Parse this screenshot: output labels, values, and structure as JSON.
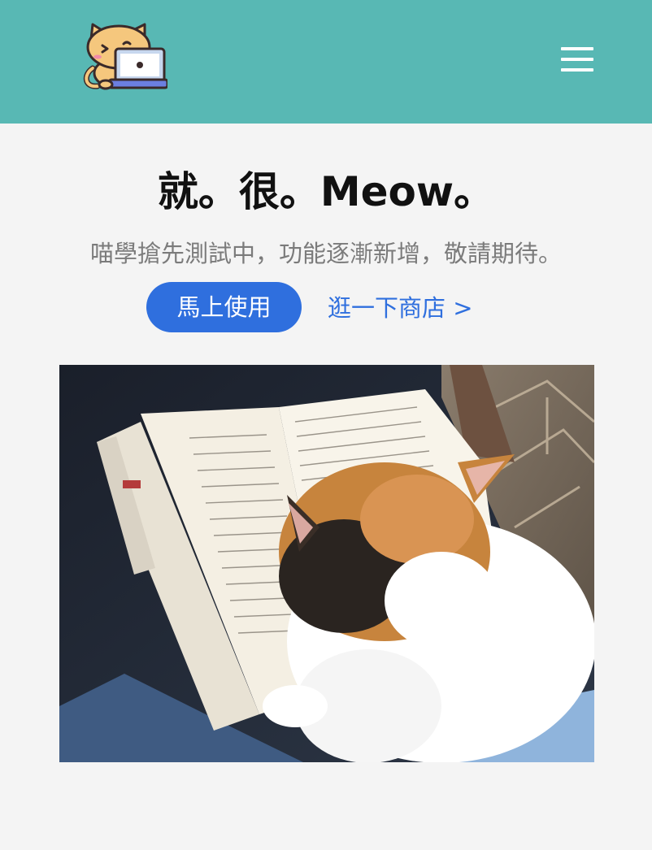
{
  "navbar": {
    "background": "#58b8b4",
    "logo_icon": "cat-with-laptop-icon",
    "menu_icon": "hamburger-menu-icon"
  },
  "hero": {
    "title": "就。很。Meow。",
    "subtitle": "喵學搶先測試中，功能逐漸新增，敬請期待。",
    "primary_cta": "馬上使用",
    "secondary_cta": "逛一下商店 >",
    "accent": "#2f6fde",
    "image_subject": "calico cat reading an open book"
  }
}
